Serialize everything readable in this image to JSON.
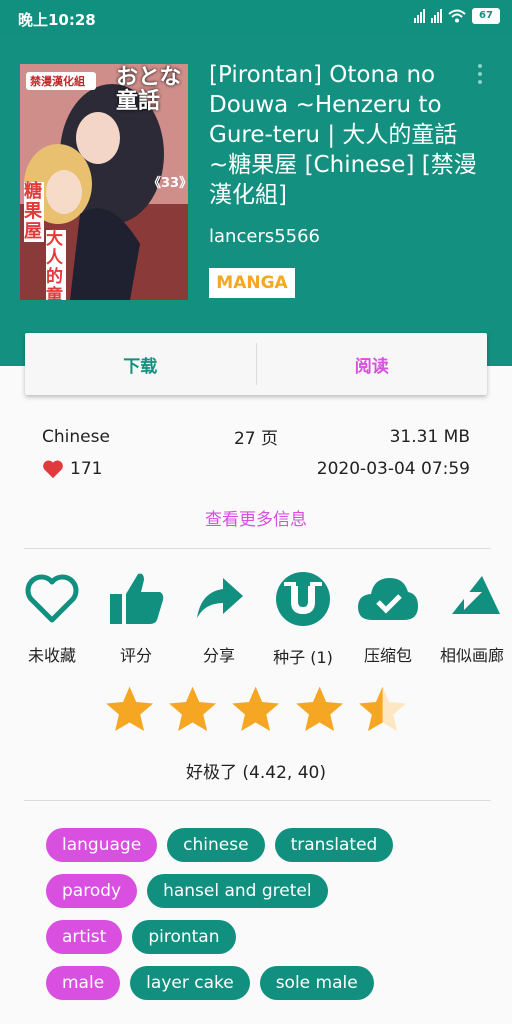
{
  "status_bar": {
    "time": "晚上10:28",
    "battery": "67"
  },
  "gallery": {
    "title": "[Pirontan] Otona no Douwa ~Henzeru to Gure-teru | 大人的童話 ~糖果屋 [Chinese] [禁漫漢化組]",
    "uploader": "lancers5566",
    "category": "MANGA",
    "cover": {
      "tag_top": "禁漫漢化組",
      "big_title": "おとな童話",
      "subtitle": "大人的童話",
      "side": "糖果屋",
      "issue": "《33》"
    }
  },
  "actions": {
    "download": "下载",
    "read": "阅读"
  },
  "info": {
    "language": "Chinese",
    "pages": "27 页",
    "size": "31.31 MB",
    "favorites": "171",
    "date": "2020-03-04 07:59",
    "more_link": "查看更多信息"
  },
  "tools": [
    {
      "label": "未收藏",
      "icon": "heart-outline-icon"
    },
    {
      "label": "评分",
      "icon": "thumbs-up-icon"
    },
    {
      "label": "分享",
      "icon": "share-arrow-icon"
    },
    {
      "label": "种子 (1)",
      "icon": "torrent-icon"
    },
    {
      "label": "压缩包",
      "icon": "cloud-check-icon"
    },
    {
      "label": "相似画廊",
      "icon": "similar-gallery-icon"
    }
  ],
  "rating": {
    "value": 4.42,
    "count": 40,
    "text": "好极了 (4.42, 40)"
  },
  "tags": [
    {
      "namespace": "language",
      "values": [
        "chinese",
        "translated"
      ]
    },
    {
      "namespace": "parody",
      "values": [
        "hansel and gretel"
      ]
    },
    {
      "namespace": "artist",
      "values": [
        "pirontan"
      ]
    },
    {
      "namespace": "male",
      "values": [
        "layer cake",
        "sole male"
      ]
    }
  ],
  "colors": {
    "primary": "#139080",
    "accent": "#d94fe0",
    "star": "#f5a623"
  }
}
